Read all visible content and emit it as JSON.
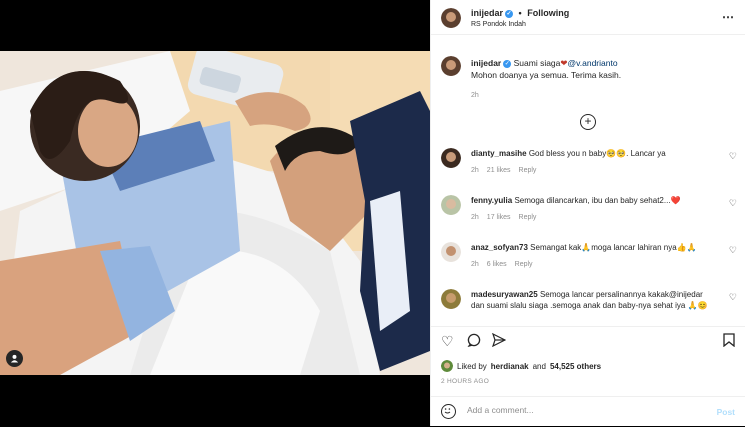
{
  "post": {
    "username": "inijedar",
    "follow_label": "Following",
    "separator": "•",
    "location": "RS Pondok Indah",
    "caption_line1_prefix": "Suami siaga",
    "caption_heart": "❤",
    "caption_mention": "@v.andrianto",
    "caption_line2": "Mohon doanya ya semua. Terima kasih.",
    "caption_time": "2h",
    "load_more": "+"
  },
  "comments": [
    {
      "user": "dianty_masihe",
      "text": "God bless you n baby🥺🥺. Lancar ya",
      "time": "2h",
      "likes": "21 likes",
      "reply": "Reply"
    },
    {
      "user": "fenny.yulia",
      "text": "Semoga dilancarkan, ibu dan baby sehat2...❤️",
      "time": "2h",
      "likes": "17 likes",
      "reply": "Reply"
    },
    {
      "user": "anaz_sofyan73",
      "text": "Semangat kak🙏moga lancar lahiran nya👍🙏",
      "time": "2h",
      "likes": "6 likes",
      "reply": "Reply"
    },
    {
      "user": "madesuryawan25",
      "text": "Semoga lancar persalinannya kakak@inijedar dan suami slalu siaga .semoga anak dan baby-nya sehat iya 🙏😊",
      "time": "",
      "likes": "",
      "reply": ""
    }
  ],
  "likes": {
    "prefix": "Liked by",
    "user": "herdianak",
    "conj": "and",
    "count": "54,525 others"
  },
  "posted_ago": "2 HOURS AGO",
  "add_comment": {
    "placeholder": "Add a comment...",
    "post_label": "Post"
  },
  "colors": {
    "verified": "#3897f0",
    "link": "#00376b",
    "muted": "#8e8e8e",
    "post_disabled": "#b2dffc"
  }
}
